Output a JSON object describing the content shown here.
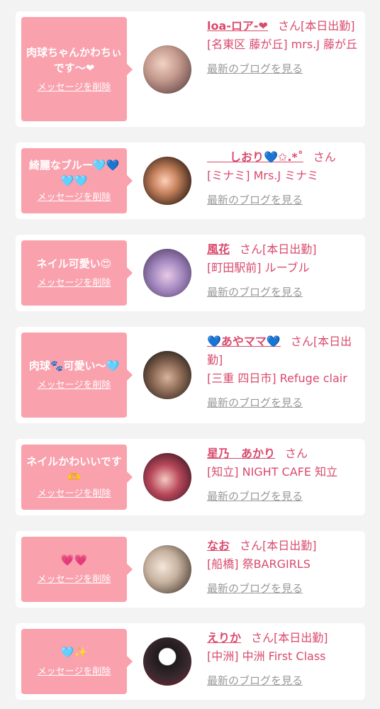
{
  "delete_label": "メッセージを削除",
  "blog_label": "最新のブログを見る",
  "san_label": "さん",
  "colors": {
    "accent_pink": "#f9a1ad",
    "name_red": "#d94a6d",
    "link_gray": "#999999",
    "background": "#f3f3f3"
  },
  "items": [
    {
      "message": "肉球ちゃんかわちぃです〜❤",
      "name": "loa-ロア-❤",
      "shift": "[本日出勤]",
      "shop": "[名東区 藤が丘] mrs.J 藤が丘",
      "avatar_icon": "cast-avatar"
    },
    {
      "message": "綺麗なブルー🩵💙🩵🩵",
      "name": "　　しおり💙✩.*˚",
      "shift": "",
      "shop": "[ミナミ] Mrs.J ミナミ",
      "avatar_icon": "cast-avatar"
    },
    {
      "message": "ネイル可愛い😍",
      "name": "風花",
      "shift": "[本日出勤]",
      "shop": "[町田駅前] ルーブル",
      "avatar_icon": "cast-avatar"
    },
    {
      "message": "肉球🐾可愛い〜🩵",
      "name": "💙あやママ💙",
      "shift": "[本日出勤]",
      "shop": "[三重 四日市] Refuge clair",
      "avatar_icon": "cast-avatar"
    },
    {
      "message": "ネイルかわいいです🫶",
      "name": "星乃　あかり",
      "shift": "",
      "shop": "[知立] NIGHT CAFE 知立",
      "avatar_icon": "cast-avatar"
    },
    {
      "message": "💗💗",
      "name": "なお",
      "shift": "[本日出勤]",
      "shop": "[船橋] 祭BARGIRLS",
      "avatar_icon": "cast-avatar"
    },
    {
      "message": "🩵✨",
      "name": "えりか",
      "shift": "[本日出勤]",
      "shop": "[中洲] 中洲 First Class",
      "avatar_icon": "cast-avatar"
    }
  ]
}
